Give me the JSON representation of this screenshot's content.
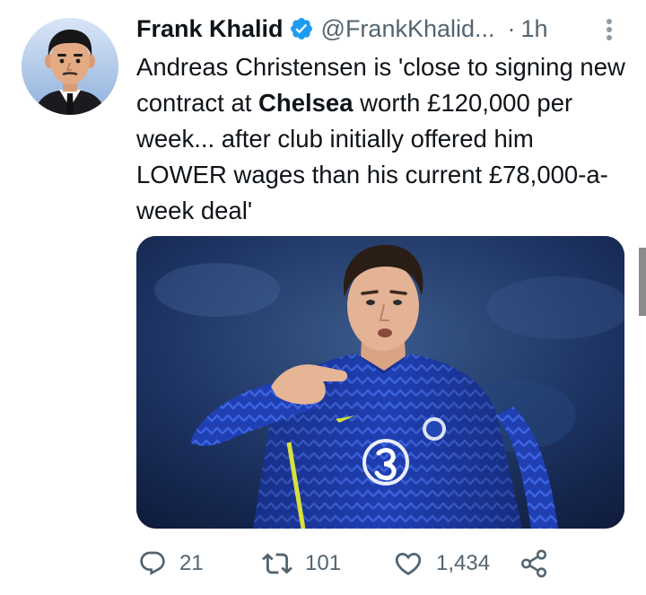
{
  "tweet": {
    "author_name": "Frank Khalid",
    "handle": "@FrankKhalid...",
    "separator": "·",
    "time": "1h",
    "text_part1": "Andreas Christensen is 'close to signing new contract at ",
    "text_bold": "Chelsea",
    "text_part2": " worth £120,000 per week... after club initially offered him LOWER wages than his current £78,000-a-week deal'",
    "verified_icon": "verified-badge-icon",
    "colors": {
      "verified": "#1d9bf0",
      "text": "#0f1419",
      "secondary": "#536471"
    }
  },
  "actions": {
    "replies": "21",
    "retweets": "101",
    "likes": "1,434",
    "reply_icon": "reply-icon",
    "retweet_icon": "retweet-icon",
    "like_icon": "heart-icon",
    "share_icon": "share-icon"
  }
}
